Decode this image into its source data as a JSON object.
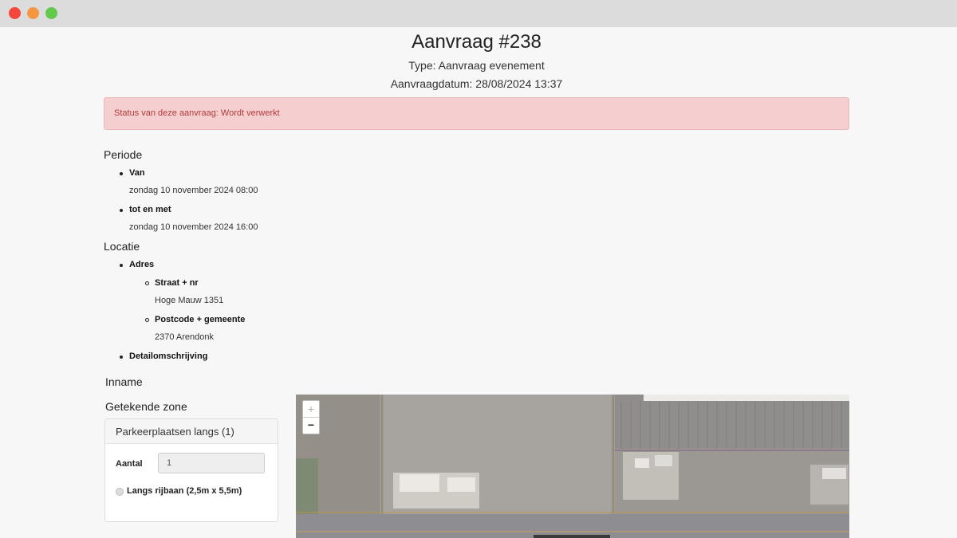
{
  "window": {
    "controls": [
      "close",
      "minimize",
      "maximize"
    ]
  },
  "header": {
    "title": "Aanvraag #238",
    "type": "Type: Aanvraag evenement",
    "date": "Aanvraagdatum: 28/08/2024 13:37"
  },
  "status": {
    "text": "Status van deze aanvraag: Wordt verwerkt",
    "color": "#f5cfcf"
  },
  "periode": {
    "heading": "Periode",
    "van_label": "Van",
    "van_value": "zondag 10 november 2024 08:00",
    "tot_label": "tot en met",
    "tot_value": "zondag 10 november 2024 16:00"
  },
  "locatie": {
    "heading": "Locatie",
    "adres_label": "Adres",
    "straat_label": "Straat + nr",
    "straat_value": "Hoge Mauw 1351",
    "postcode_label": "Postcode + gemeente",
    "postcode_value": "2370 Arendonk",
    "detail_label": "Detailomschrijving"
  },
  "inname": {
    "heading": "Inname",
    "zone_heading": "Getekende zone",
    "panel_title": "Parkeerplaatsen langs (1)",
    "aantal_label": "Aantal",
    "aantal_value": "1",
    "option_label": "Langs rijbaan (2,5m x 5,5m)"
  },
  "map": {
    "zoom_in": "+",
    "zoom_out": "−"
  }
}
